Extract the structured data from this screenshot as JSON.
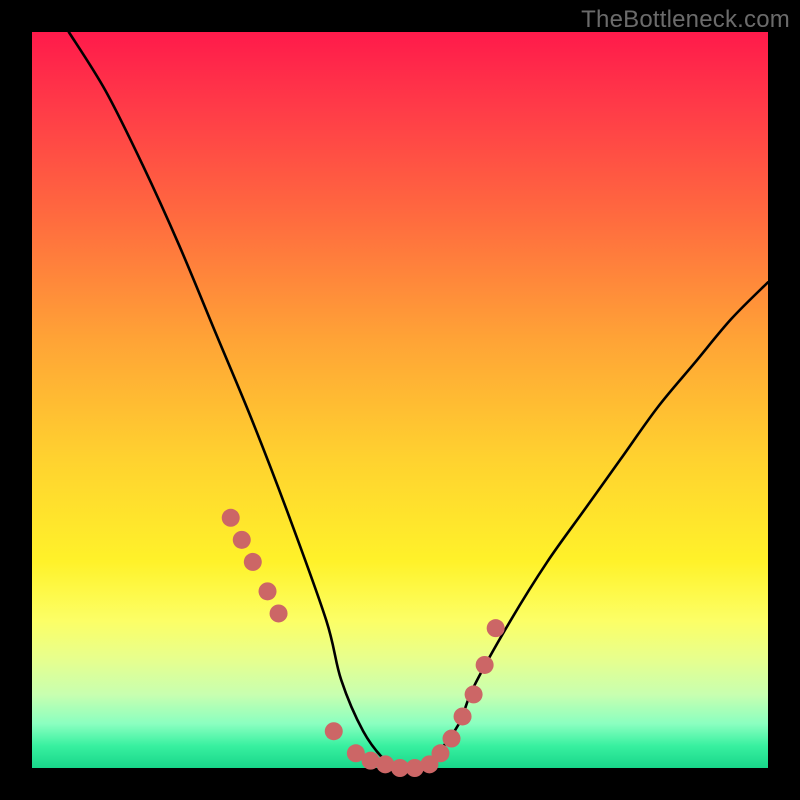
{
  "watermark": "TheBottleneck.com",
  "chart_data": {
    "type": "line",
    "title": "",
    "xlabel": "",
    "ylabel": "",
    "xlim": [
      0,
      100
    ],
    "ylim": [
      0,
      100
    ],
    "grid": false,
    "legend": false,
    "series": [
      {
        "name": "bottleneck-curve",
        "color": "#000000",
        "x": [
          5,
          10,
          15,
          20,
          25,
          30,
          35,
          40,
          42,
          45,
          48,
          50,
          52,
          55,
          58,
          60,
          65,
          70,
          75,
          80,
          85,
          90,
          95,
          100
        ],
        "y": [
          100,
          92,
          82,
          71,
          59,
          47,
          34,
          20,
          12,
          5,
          1,
          0,
          0,
          2,
          6,
          11,
          20,
          28,
          35,
          42,
          49,
          55,
          61,
          66
        ]
      },
      {
        "name": "marker-dots",
        "color": "#cc6666",
        "type": "scatter",
        "x": [
          27,
          28.5,
          30,
          32,
          33.5,
          41,
          44,
          46,
          48,
          50,
          52,
          54,
          55.5,
          57,
          58.5,
          60,
          61.5,
          63
        ],
        "y": [
          34,
          31,
          28,
          24,
          21,
          5,
          2,
          1,
          0.5,
          0,
          0,
          0.5,
          2,
          4,
          7,
          10,
          14,
          19
        ]
      }
    ],
    "background_gradient": {
      "top": "#ff1a4b",
      "middle": "#ffd22f",
      "bottom": "#18d68a"
    }
  }
}
